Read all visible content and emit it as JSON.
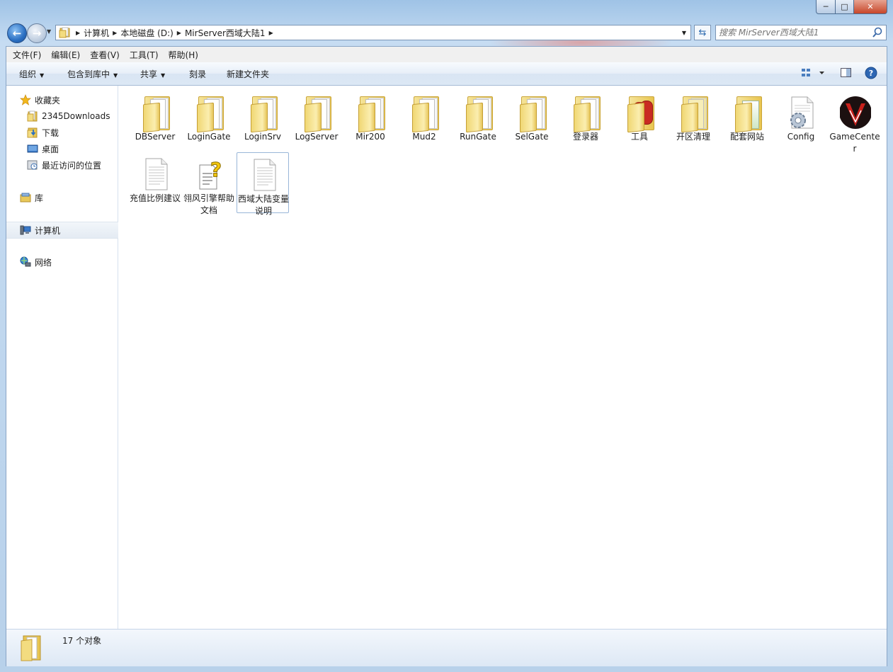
{
  "window": {
    "caption_buttons": {
      "minimize": "─",
      "maximize": "□",
      "close": "✕"
    }
  },
  "nav": {
    "breadcrumbs": [
      "计算机",
      "本地磁盘 (D:)",
      "MirServer西域大陆1"
    ],
    "search_placeholder": "搜索 MirServer西域大陆1"
  },
  "menu": [
    "文件(F)",
    "编辑(E)",
    "查看(V)",
    "工具(T)",
    "帮助(H)"
  ],
  "toolbar": {
    "organize": "组织",
    "include_library": "包含到库中",
    "share": "共享",
    "burn": "刻录",
    "new_folder": "新建文件夹"
  },
  "sidebar": {
    "favorites": "收藏夹",
    "downloads_folder": "2345Downloads",
    "downloads": "下载",
    "desktop": "桌面",
    "recent": "最近访问的位置",
    "libraries": "库",
    "computer": "计算机",
    "network": "网络"
  },
  "files": [
    {
      "name": "DBServer",
      "icon": "folder-icon"
    },
    {
      "name": "LoginGate",
      "icon": "folder-icon"
    },
    {
      "name": "LoginSrv",
      "icon": "folder-icon"
    },
    {
      "name": "LogServer",
      "icon": "folder-icon"
    },
    {
      "name": "Mir200",
      "icon": "folder-icon"
    },
    {
      "name": "Mud2",
      "icon": "folder-icon"
    },
    {
      "name": "RunGate",
      "icon": "folder-icon"
    },
    {
      "name": "SelGate",
      "icon": "folder-icon"
    },
    {
      "name": "登录器",
      "icon": "folder-icon"
    },
    {
      "name": "工具",
      "icon": "folder-icon"
    },
    {
      "name": "开区清理",
      "icon": "folder-icon"
    },
    {
      "name": "配套网站",
      "icon": "folder-icon"
    },
    {
      "name": "Config",
      "icon": "config-file-icon"
    },
    {
      "name": "GameCenter",
      "icon": "gamecenter-app-icon"
    },
    {
      "name": "充值比例建议",
      "icon": "text-file-icon"
    },
    {
      "name": "翎风引擎帮助文档",
      "icon": "help-file-icon"
    },
    {
      "name": "西域大陆变量说明",
      "icon": "text-file-icon"
    }
  ],
  "status": {
    "count_text": "17 个对象"
  }
}
